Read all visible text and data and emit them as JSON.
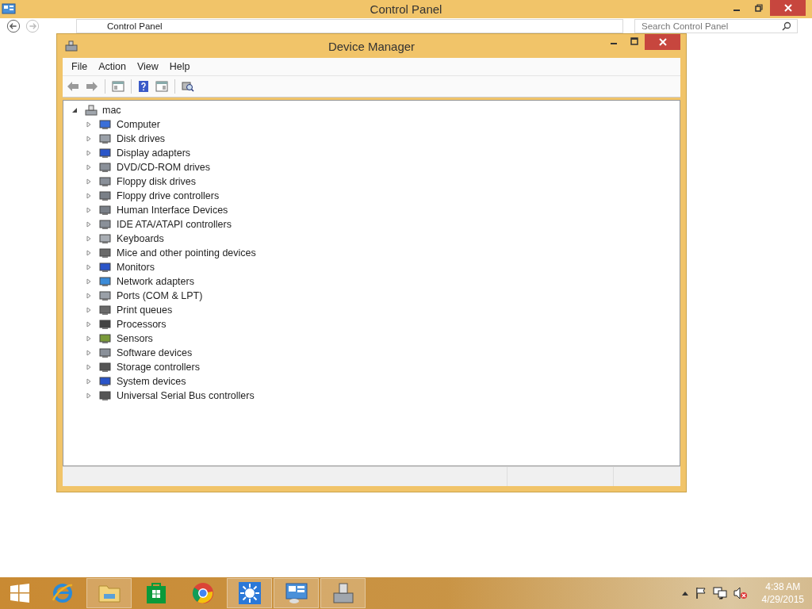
{
  "control_panel": {
    "title": "Control Panel",
    "address": {
      "crumb": "Control Panel"
    },
    "search": {
      "placeholder": "Search Control Panel"
    }
  },
  "device_manager": {
    "title": "Device Manager",
    "menu": [
      "File",
      "Action",
      "View",
      "Help"
    ],
    "tree": {
      "label": "mac",
      "expanded": true,
      "children": [
        {
          "label": "Computer",
          "expanded": false
        },
        {
          "label": "Disk drives",
          "expanded": false
        },
        {
          "label": "Display adapters",
          "expanded": false
        },
        {
          "label": "DVD/CD-ROM drives",
          "expanded": false
        },
        {
          "label": "Floppy disk drives",
          "expanded": false
        },
        {
          "label": "Floppy drive controllers",
          "expanded": false
        },
        {
          "label": "Human Interface Devices",
          "expanded": false
        },
        {
          "label": "IDE ATA/ATAPI controllers",
          "expanded": false
        },
        {
          "label": "Keyboards",
          "expanded": false
        },
        {
          "label": "Mice and other pointing devices",
          "expanded": false
        },
        {
          "label": "Monitors",
          "expanded": false
        },
        {
          "label": "Network adapters",
          "expanded": false
        },
        {
          "label": "Ports (COM & LPT)",
          "expanded": false
        },
        {
          "label": "Print queues",
          "expanded": false
        },
        {
          "label": "Processors",
          "expanded": false
        },
        {
          "label": "Sensors",
          "expanded": false
        },
        {
          "label": "Software devices",
          "expanded": false
        },
        {
          "label": "Storage controllers",
          "expanded": false
        },
        {
          "label": "System devices",
          "expanded": false
        },
        {
          "label": "Universal Serial Bus controllers",
          "expanded": false
        }
      ]
    }
  },
  "taskbar": {
    "apps": [
      {
        "open": false
      },
      {
        "open": true
      },
      {
        "open": false
      },
      {
        "open": false
      },
      {
        "open": true
      },
      {
        "open": true
      },
      {
        "open": true
      }
    ],
    "clock": {
      "time": "4:38 AM",
      "date": "4/29/2015"
    }
  }
}
